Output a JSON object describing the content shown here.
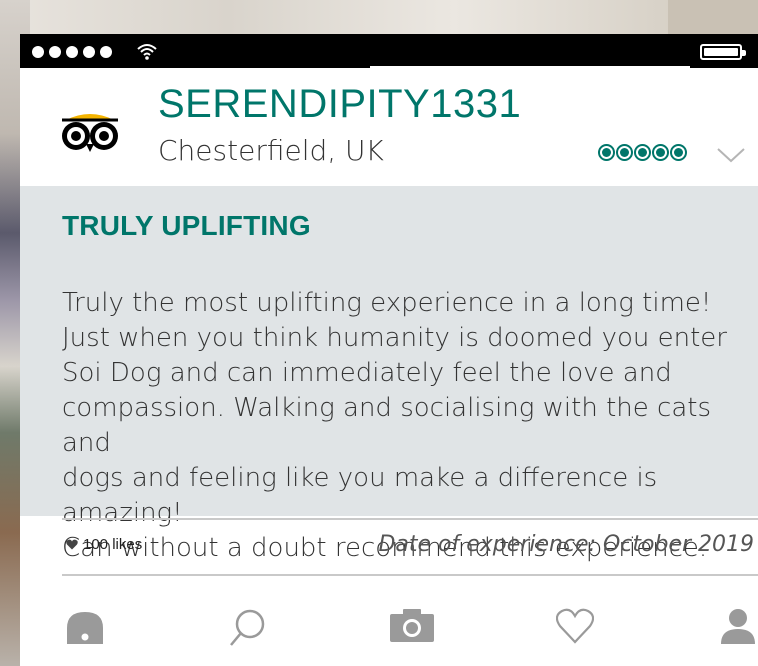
{
  "status_bar": {
    "signal_dots": 5,
    "wifi_icon": "wifi-icon",
    "battery_icon": "battery-icon"
  },
  "reviewer": {
    "username": "SERENDIPITY1331",
    "location": "Chesterfield, UK",
    "logo_icon": "tripadvisor-owl-icon",
    "rating": 5,
    "rating_max": 5,
    "expand_icon": "chevron-down-icon"
  },
  "review": {
    "title": "TRULY UPLIFTING",
    "text": "Truly the most uplifting experience in a long time!\nJust when you think humanity is doomed you enter\nSoi Dog and can immediately feel the love and\ncompassion. Walking and socialising with the cats and\ndogs and feeling like you make a difference is amazing!\nCan without a doubt recommend this experience."
  },
  "footer": {
    "likes": "100 likes",
    "date_of_experience": "Date of experience: October 2019"
  },
  "nav": {
    "items": [
      {
        "icon": "home-icon"
      },
      {
        "icon": "search-icon"
      },
      {
        "icon": "camera-icon"
      },
      {
        "icon": "heart-icon"
      },
      {
        "icon": "profile-icon"
      }
    ]
  },
  "colors": {
    "brand": "#00766a",
    "review_bg": "#e0e4e6",
    "text": "#333333",
    "icon_gray": "#9a9a9a"
  }
}
